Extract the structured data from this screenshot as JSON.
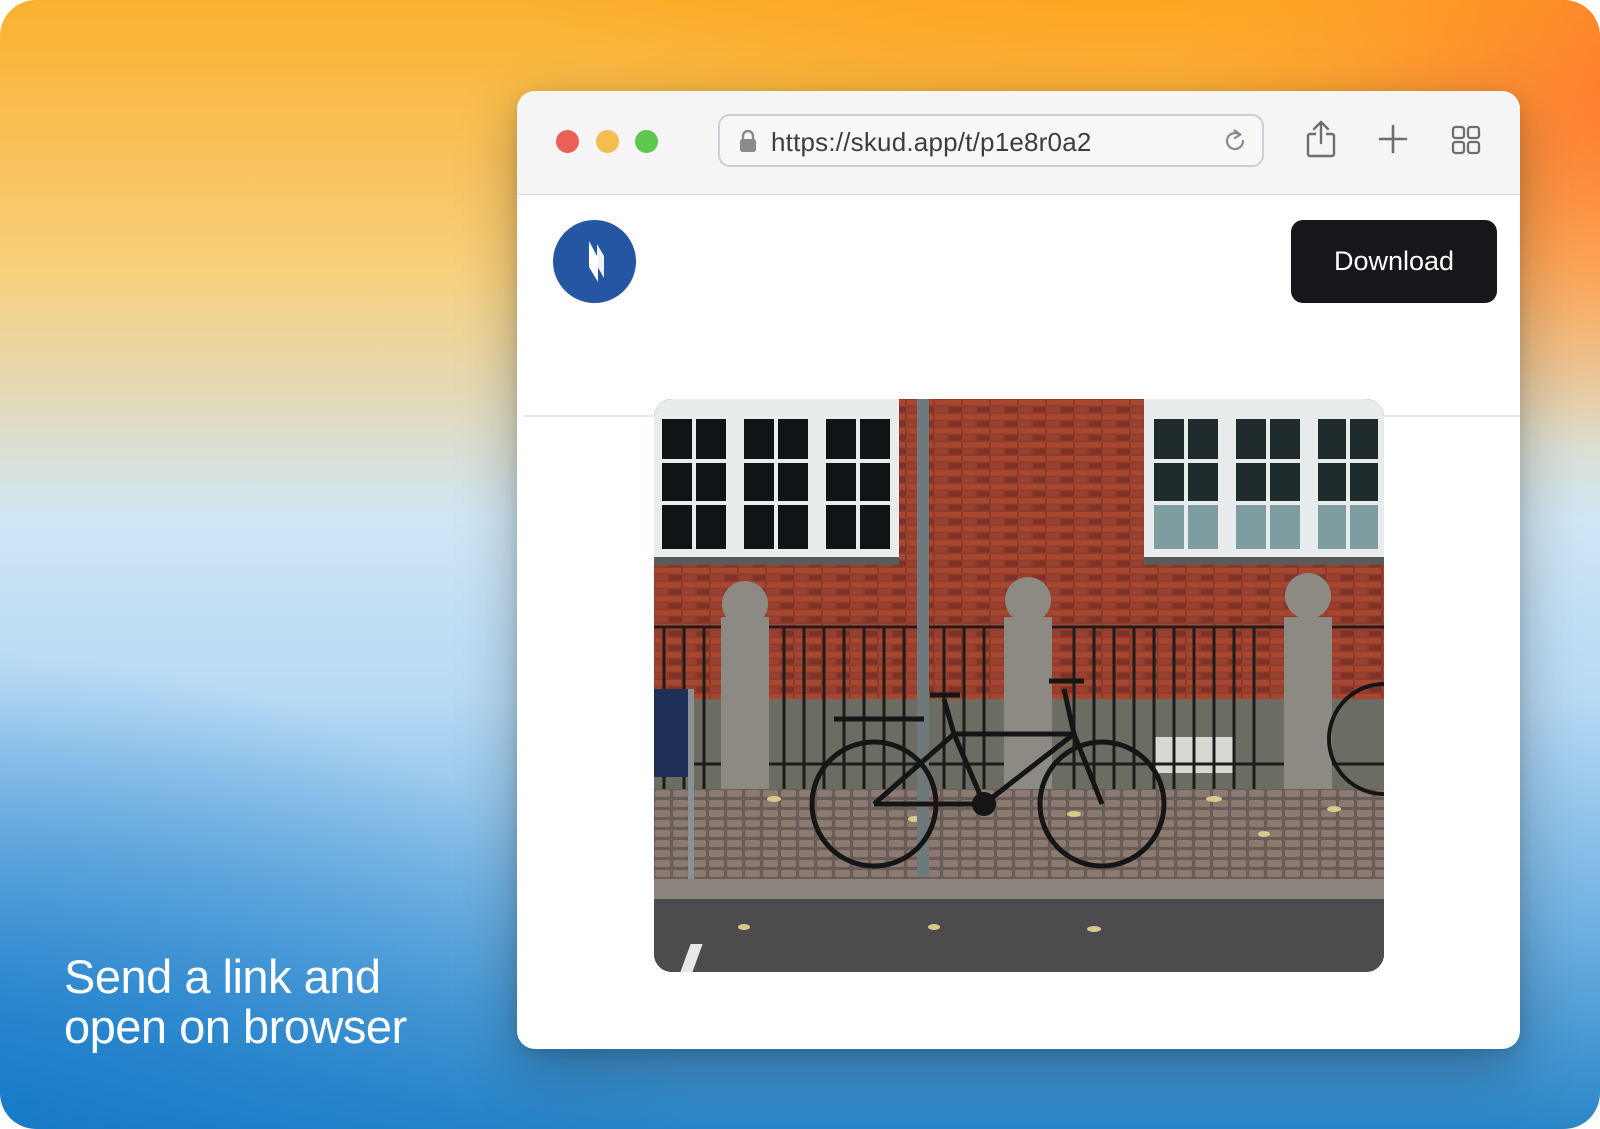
{
  "tagline": {
    "line1": "Send a link and",
    "line2": "open on browser"
  },
  "browser": {
    "url": "https://skud.app/t/p1e8r0a2",
    "icons": [
      "lock-icon",
      "reload-icon",
      "share-icon",
      "plus-icon",
      "tabs-icon"
    ],
    "traffic_lights": [
      "#ec5f59",
      "#f3bd4f",
      "#5ec74e"
    ]
  },
  "site": {
    "logo_color": "#2456a4",
    "download_label": "Download"
  },
  "photo": {
    "subject": "bicycle-photo"
  }
}
